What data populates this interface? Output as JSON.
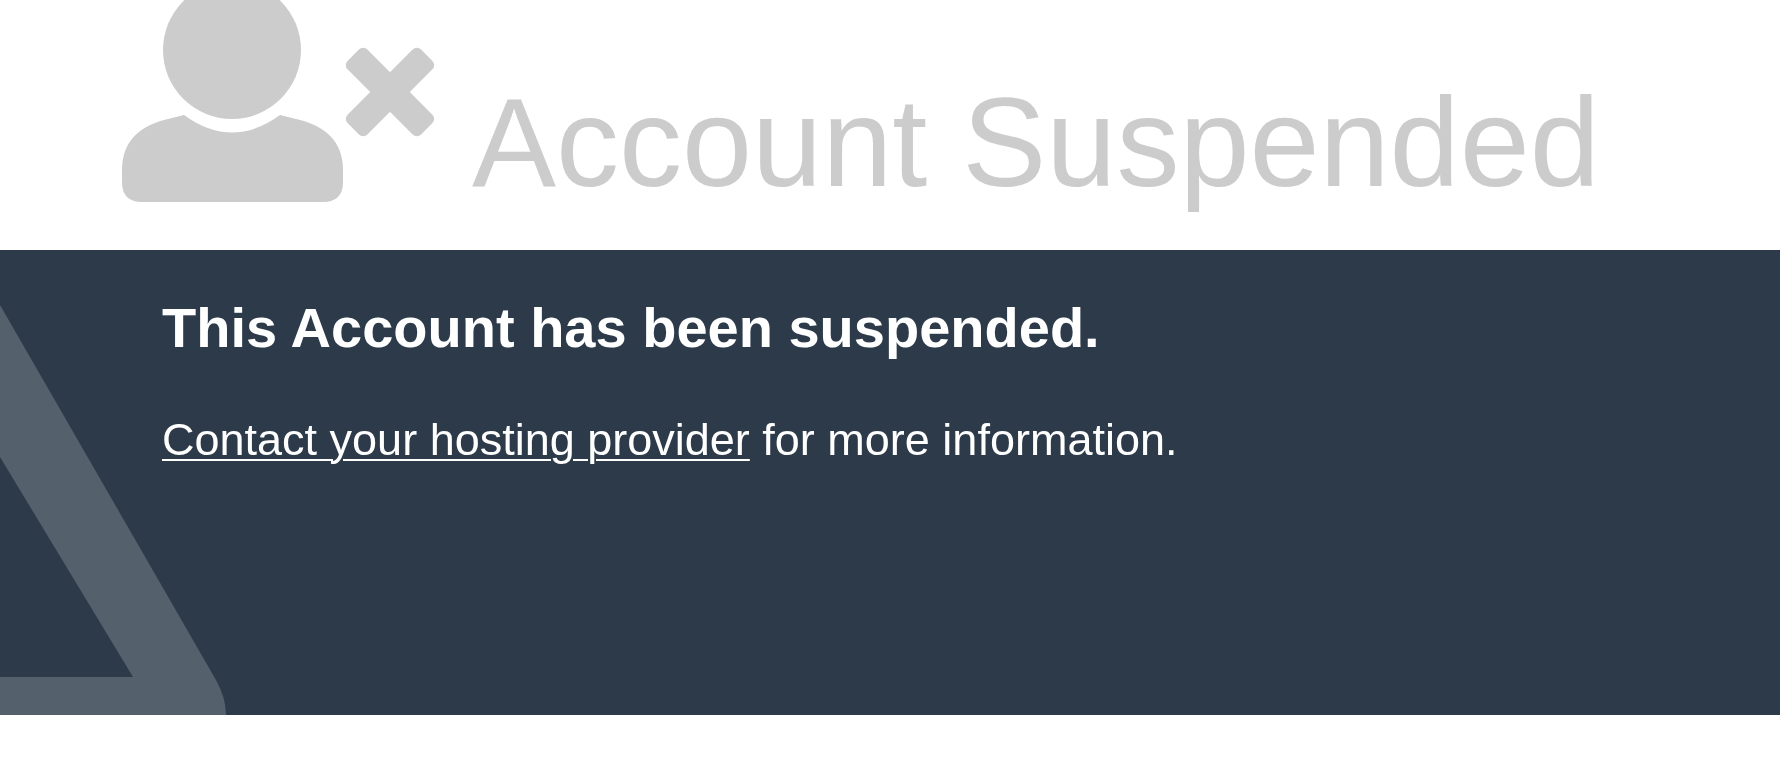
{
  "header": {
    "title": "Account Suspended"
  },
  "notice": {
    "heading": "This Account has been suspended.",
    "message": {
      "link": "Contact your hosting provider",
      "text": "for more information."
    }
  }
}
